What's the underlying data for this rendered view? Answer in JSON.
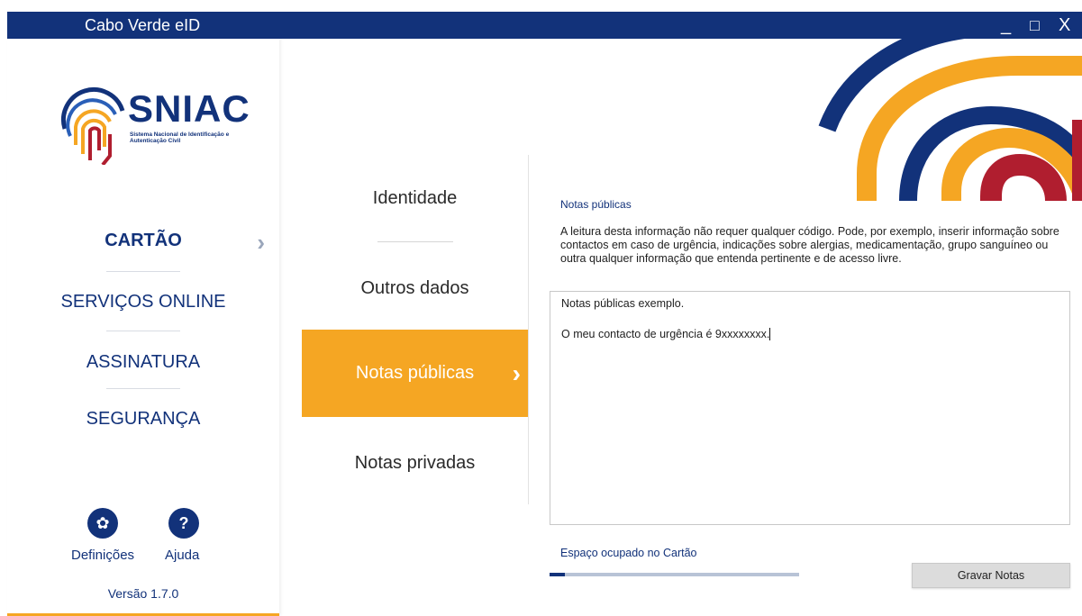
{
  "window": {
    "title": "Cabo Verde eID",
    "controls": {
      "minimize": "_",
      "maximize": "□",
      "close": "X"
    }
  },
  "logo": {
    "name": "SNIAC",
    "subtitle": "Sistema Nacional de Identificação e Autenticação Civil"
  },
  "sidebar": {
    "items": [
      {
        "label": "CARTÃO",
        "active": true
      },
      {
        "label": "SERVIÇOS ONLINE",
        "active": false
      },
      {
        "label": "ASSINATURA",
        "active": false
      },
      {
        "label": "SEGURANÇA",
        "active": false
      }
    ],
    "settings_label": "Definições",
    "help_label": "Ajuda",
    "version": "Versão 1.7.0"
  },
  "subnav": {
    "items": [
      {
        "label": "Identidade",
        "active": false
      },
      {
        "label": "Outros dados",
        "active": false
      },
      {
        "label": "Notas públicas",
        "active": true
      },
      {
        "label": "Notas privadas",
        "active": false
      }
    ]
  },
  "content": {
    "section_title": "Notas públicas",
    "description": "A leitura desta informação não requer qualquer código. Pode, por exemplo, inserir informação sobre contactos em caso de urgência, indicações sobre alergias, medicamentação, grupo sanguíneo ou outra qualquer informação que entenda pertinente e de acesso livre.",
    "notes_lines": [
      "Notas públicas exemplo.",
      "O meu contacto de urgência é 9xxxxxxxx."
    ],
    "space_label": "Espaço ocupado no Cartão",
    "space_used_percent": 6,
    "save_button": "Gravar Notas"
  },
  "icons": {
    "settings": "gear-icon",
    "help": "question-icon",
    "chevron": "chevron-right-icon"
  },
  "colors": {
    "primary": "#12327a",
    "accent": "#f5a623",
    "red": "#b01e2f"
  }
}
